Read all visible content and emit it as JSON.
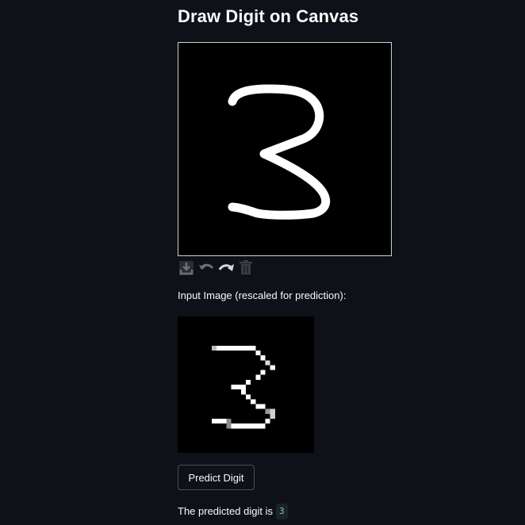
{
  "page": {
    "title": "Draw Digit on Canvas",
    "caption": "Input Image (rescaled for prediction):",
    "predict_button": "Predict Digit",
    "result_prefix": "The predicted digit is",
    "result_value": "3"
  },
  "toolbar": {
    "tools": [
      "download-icon",
      "undo-icon",
      "redo-icon",
      "trash-icon"
    ]
  },
  "colors": {
    "background": "#0e1117",
    "text": "#fafafa",
    "stroke": "#ffffff",
    "result_code": "#5ce488"
  }
}
